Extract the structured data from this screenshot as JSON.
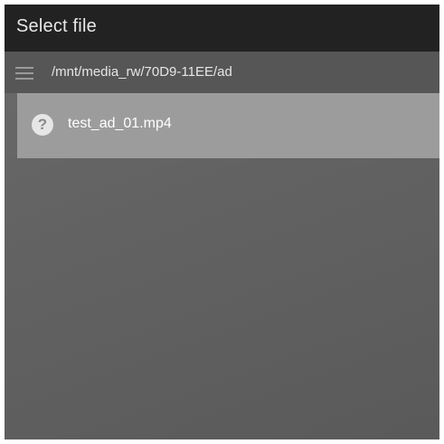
{
  "dialog": {
    "title": "Select file"
  },
  "path_bar": {
    "menu_icon": "hamburger-menu-icon",
    "path": "/mnt/media_rw/70D9-11EE/ad"
  },
  "files": [
    {
      "icon": "question-mark-icon",
      "icon_glyph": "?",
      "name": "test_ad_01.mp4"
    }
  ]
}
